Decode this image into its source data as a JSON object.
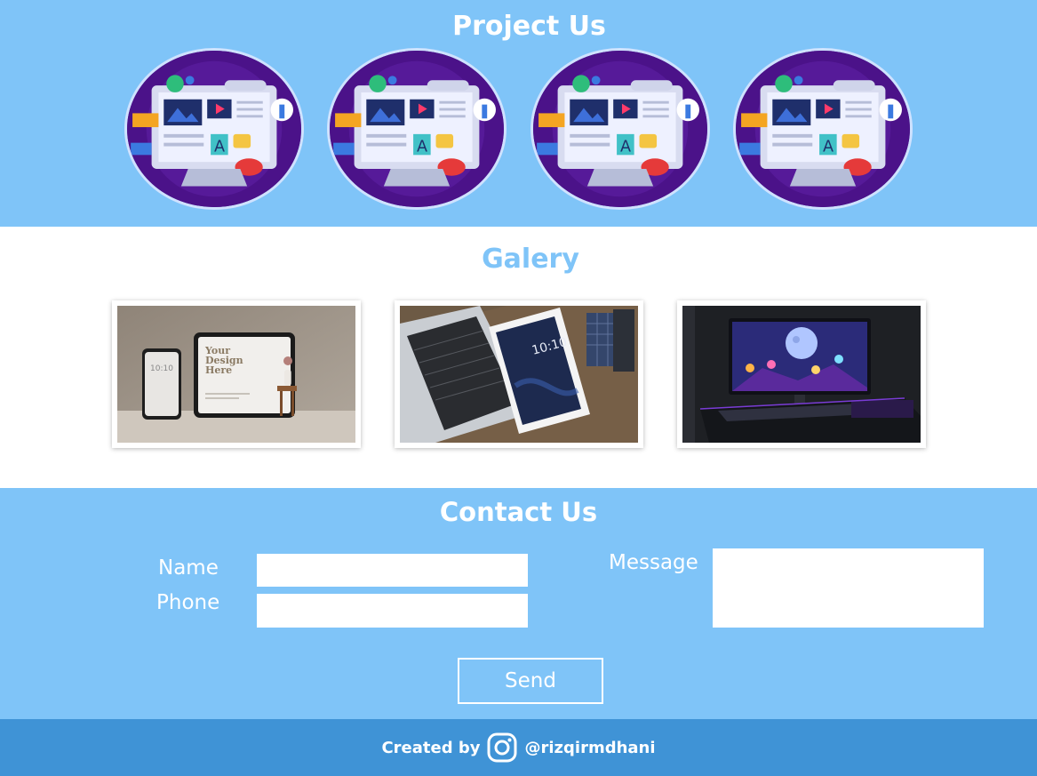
{
  "project": {
    "title": "Project Us",
    "items": [
      {
        "icon": "web-design-monitor-icon"
      },
      {
        "icon": "web-design-monitor-icon"
      },
      {
        "icon": "web-design-monitor-icon"
      },
      {
        "icon": "web-design-monitor-icon"
      }
    ]
  },
  "gallery": {
    "title": "Galery",
    "photos": [
      {
        "text": "Your\nDesign\nHere",
        "time": "10:10"
      },
      {
        "time": "10:10"
      },
      {}
    ]
  },
  "contact": {
    "title": "Contact Us",
    "name_label": "Name",
    "phone_label": "Phone",
    "message_label": "Message",
    "name_value": "",
    "phone_value": "",
    "message_value": "",
    "send_label": "Send"
  },
  "footer": {
    "prefix": "Created by",
    "handle": "@rizqirmdhani",
    "icon": "instagram-icon"
  },
  "colors": {
    "primary": "#7fc4f8",
    "footer": "#3f93d6",
    "white": "#ffffff"
  }
}
